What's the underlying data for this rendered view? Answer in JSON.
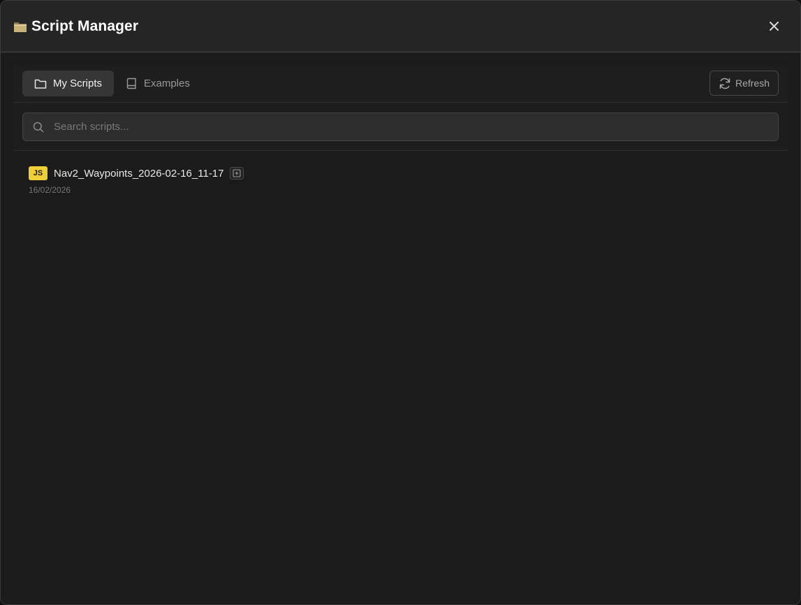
{
  "modal": {
    "title": "Script Manager",
    "title_icon": "folder-icon",
    "close_icon": "close-icon"
  },
  "tabs": [
    {
      "label": "My Scripts",
      "icon": "folder-outline-icon",
      "active": true
    },
    {
      "label": "Examples",
      "icon": "book-icon",
      "active": false
    }
  ],
  "toolbar": {
    "refresh_label": "Refresh",
    "refresh_icon": "refresh-icon"
  },
  "search": {
    "placeholder": "Search scripts...",
    "value": ""
  },
  "scripts": [
    {
      "badge": "JS",
      "name": "Nav2_Waypoints_2026-02-16_11-17",
      "date": "16/02/2026",
      "action_icon": "open-in-editor-icon"
    }
  ],
  "colors": {
    "js_badge": "#f0cf3a",
    "background": "#1b1b1b",
    "header": "#252525"
  }
}
